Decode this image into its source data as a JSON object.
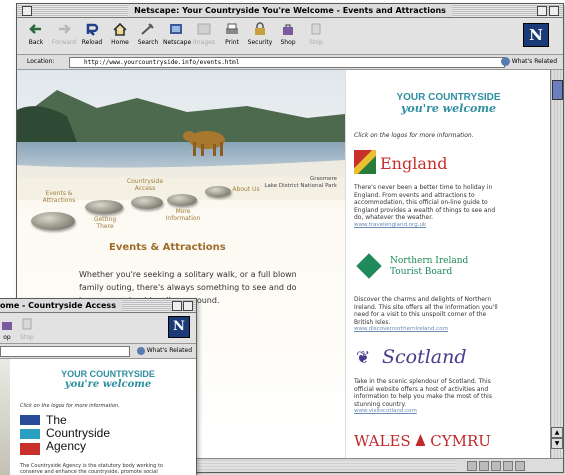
{
  "main_window": {
    "title": "Netscape: Your Countryside You're Welcome - Events and Attractions",
    "toolbar": [
      {
        "label": "Back",
        "icon": "back-arrow-icon",
        "enabled": true
      },
      {
        "label": "Forward",
        "icon": "forward-arrow-icon",
        "enabled": false
      },
      {
        "label": "Reload",
        "icon": "reload-icon",
        "enabled": true
      },
      {
        "label": "Home",
        "icon": "home-icon",
        "enabled": true
      },
      {
        "label": "Search",
        "icon": "search-icon",
        "enabled": true
      },
      {
        "label": "Netscape",
        "icon": "netscape-icon",
        "enabled": true
      },
      {
        "label": "Images",
        "icon": "images-icon",
        "enabled": false
      },
      {
        "label": "Print",
        "icon": "print-icon",
        "enabled": true
      },
      {
        "label": "Security",
        "icon": "security-lock-icon",
        "enabled": true
      },
      {
        "label": "Shop",
        "icon": "shop-bag-icon",
        "enabled": true
      },
      {
        "label": "Stop",
        "icon": "stop-icon",
        "enabled": false
      }
    ],
    "location_label": "Location:",
    "url": "http://www.yourcountryside.info/events.html",
    "related_label": "What's Related",
    "netscape_logo": "N",
    "photo_caption_line1": "Grasmere",
    "photo_caption_line2": "Lake District National Park",
    "nav_stones": [
      {
        "label": "Events & Attractions"
      },
      {
        "label": "Getting There"
      },
      {
        "label": "Countryside Access"
      },
      {
        "label": "More Information"
      },
      {
        "label": "About Us"
      }
    ],
    "heading": "Events & Attractions",
    "intro": "Whether you're seeking a solitary walk, or a full blown family outing, there's always something to see and do in your countryside, all year round.",
    "brand_line1": "YOUR COUNTRYSIDE",
    "brand_line2": "you're welcome",
    "click_info": "Click on the logos for more information.",
    "partners": [
      {
        "name": "England",
        "blurb": "There's never been a better time to holiday in England. From events and attractions to accommodation, this official on-line guide to England provides a wealth of things to see and do, whatever the weather.",
        "url": "www.travelengland.org.uk"
      },
      {
        "name_line1": "Northern Ireland",
        "name_line2": "Tourist Board",
        "blurb": "Discover the charms and delights of Northern Ireland. This site offers all the information you'll need for a visit to this unspoilt corner of the British Isles.",
        "url": "www.discovernorthernireland.com"
      },
      {
        "name": "Scotland",
        "blurb": "Take in the scenic splendour of Scotland. This official website offers a host of activities and information to help you make the most of this stunning country.",
        "url": "www.visitscotland.com"
      },
      {
        "name_left": "WALES",
        "name_right": "CYMRU"
      }
    ]
  },
  "second_window": {
    "title": "ome - Countryside Access",
    "toolbar": [
      {
        "label": "op",
        "icon": "shop-bag-icon"
      },
      {
        "label": "Stop",
        "icon": "stop-icon"
      }
    ],
    "related_label": "What's Related",
    "netscape_logo": "N",
    "brand_line1": "YOUR COUNTRYSIDE",
    "brand_line2": "you're welcome",
    "click_info": "Click on the logos for more information.",
    "agency_line1": "The",
    "agency_line2": "Countryside",
    "agency_line3": "Agency",
    "blurb": "The Countryside Agency is the statutory body working to conserve and enhance the countryside, promote social equity"
  },
  "colors": {
    "brand_teal": "#2f8fa0",
    "heading_brown": "#a06c2e",
    "england_red": "#c8302c",
    "wales_red": "#c0282c",
    "scotland_purple": "#4a3a8a",
    "ni_green": "#1f8a5a",
    "scroll_thumb": "#6a7ec0"
  }
}
